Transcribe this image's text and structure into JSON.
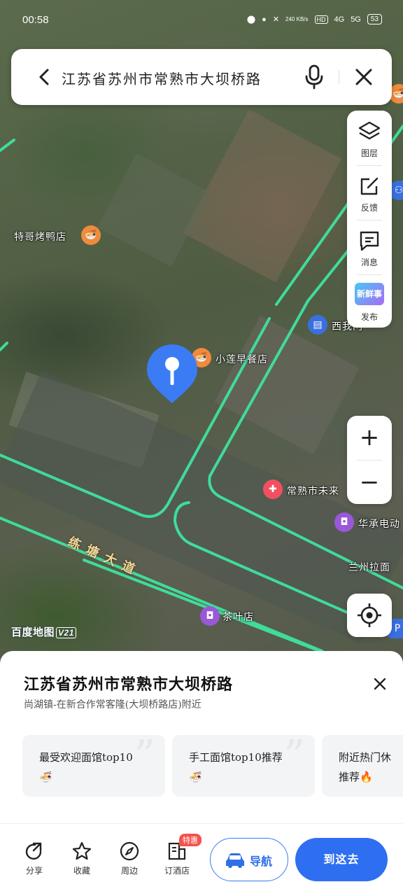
{
  "status_bar": {
    "time": "00:58",
    "net_speed": "240 KB/s",
    "hd": "HD",
    "signal1": "4G",
    "signal2": "5G",
    "battery": "53"
  },
  "search": {
    "query": "江苏省苏州市常熟市大坝桥路"
  },
  "tools": [
    {
      "label": "图层",
      "icon": "layers-icon"
    },
    {
      "label": "反馈",
      "icon": "feedback-icon"
    },
    {
      "label": "消息",
      "icon": "message-icon"
    },
    {
      "label": "发布",
      "icon": "fresh-news-icon"
    }
  ],
  "fresh_badge": "新鲜事",
  "zoom": {
    "in": "+",
    "out": "−"
  },
  "map": {
    "road_name": "练塘大道",
    "watermark": "百度地图",
    "watermark_version": "V21",
    "pois": [
      {
        "name": "特哥烤鸭店",
        "icon": "restaurant-icon",
        "color": "#f08a3c"
      },
      {
        "name": "小莲早餐店",
        "icon": "restaurant-icon",
        "color": "#f08a3c"
      },
      {
        "name": "西我门",
        "icon": "building-icon",
        "color": "#3a6fe0"
      },
      {
        "name": "常熟市未来",
        "icon": "pharmacy-icon",
        "color": "#f05062"
      },
      {
        "name": "华承电动",
        "icon": "shopping-bag-icon",
        "color": "#9a58d8"
      },
      {
        "name": "兰州拉面",
        "icon": "restaurant-icon",
        "color": "#f08a3c"
      },
      {
        "name": "茶叶店",
        "icon": "shopping-bag-icon",
        "color": "#9a58d8"
      }
    ],
    "road_color": "#3ee3a0"
  },
  "sheet": {
    "title": "江苏省苏州市常熟市大坝桥路",
    "subtitle": "尚湖镇-在新合作常客隆(大坝桥路店)附近",
    "cards": [
      {
        "line1": "最受欢迎面馆top10",
        "line2": "🍜"
      },
      {
        "line1": "手工面馆top10推荐",
        "line2": "🍜"
      },
      {
        "line1": "附近热门休",
        "line2": "推荐🔥"
      }
    ]
  },
  "bottom_bar": {
    "items": [
      {
        "label": "分享",
        "icon": "share-icon"
      },
      {
        "label": "收藏",
        "icon": "star-icon"
      },
      {
        "label": "周边",
        "icon": "compass-icon"
      },
      {
        "label": "订酒店",
        "icon": "hotel-icon"
      }
    ],
    "badge": "特惠",
    "nav_label": "导航",
    "go_label": "到这去"
  },
  "colors": {
    "accent": "#2e6ff2",
    "pin": "#3b7cf5"
  }
}
